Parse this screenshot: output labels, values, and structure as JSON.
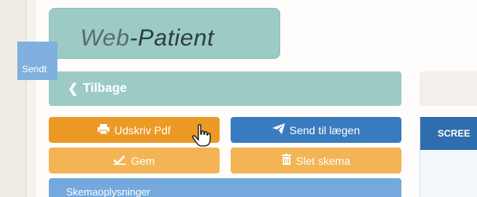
{
  "logo": {
    "part1": "Web",
    "separator": "-",
    "part2": "Patient"
  },
  "back_button": {
    "label": "Tilbage",
    "icon": "chevron-left-icon"
  },
  "toolbar": {
    "print_label": "Udskriv Pdf",
    "print_icon": "printer-icon",
    "send_label": "Send til lægen",
    "send_icon": "paper-plane-icon",
    "save_label": "Gem",
    "save_icon": "checkmark-icon",
    "delete_label": "Slet skema",
    "delete_icon": "trash-icon"
  },
  "info_section": {
    "title": "Skemaoplysninger"
  },
  "screen_panel": {
    "title": "SCREE",
    "card_text": "Sendt"
  },
  "colors": {
    "teal": "#9ccbc6",
    "orange": "#ec9a26",
    "light_orange": "#f2b455",
    "blue": "#3a7bbf",
    "light_blue": "#75a8dc"
  }
}
